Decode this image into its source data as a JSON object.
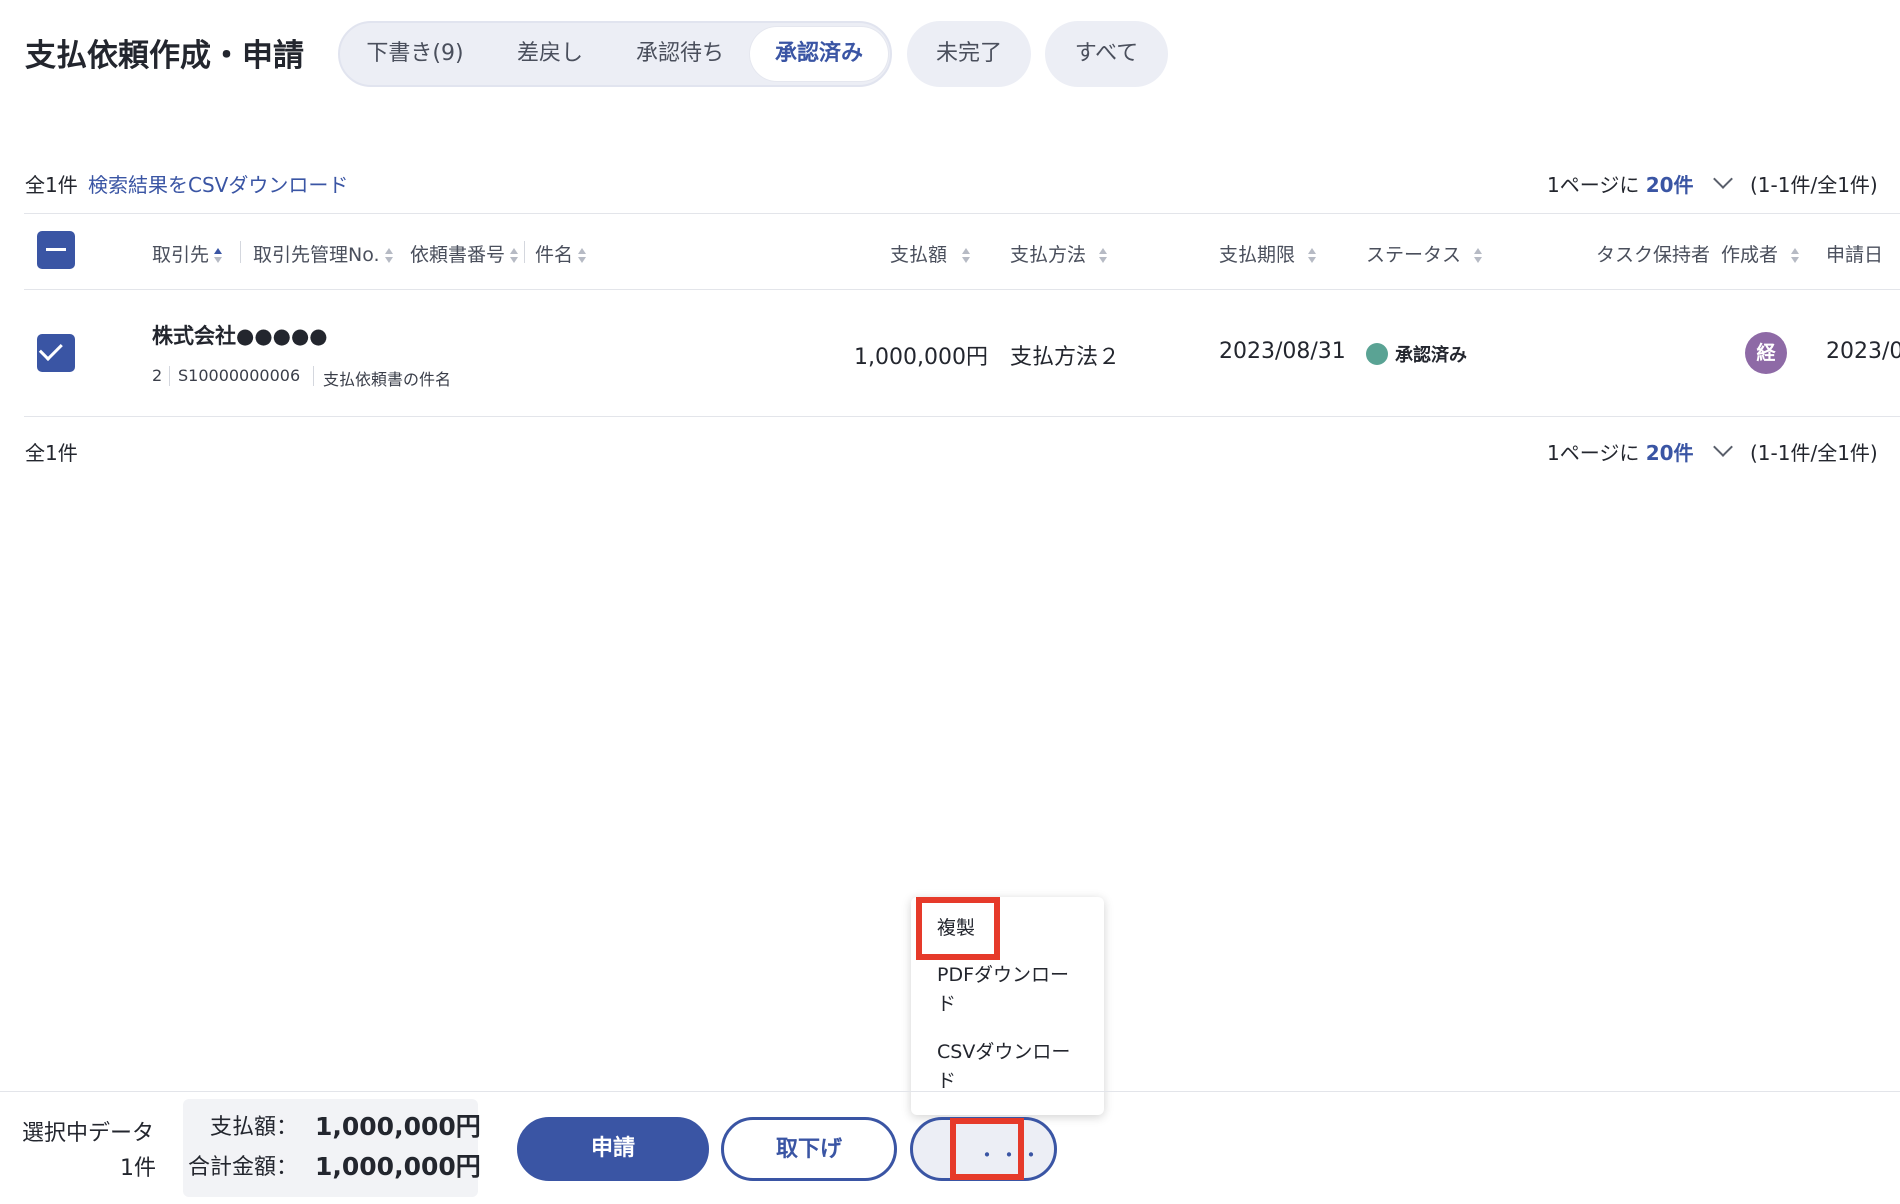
{
  "page_title": "支払依頼作成・申請",
  "tabs": [
    {
      "label": "下書き(9)"
    },
    {
      "label": "差戻し"
    },
    {
      "label": "承認待ち"
    },
    {
      "label": "承認済み"
    }
  ],
  "extra_tabs": [
    {
      "label": "未完了"
    },
    {
      "label": "すべて"
    }
  ],
  "top_bar": {
    "count": "全1件",
    "csv_link": "検索結果をCSVダウンロード",
    "per_page_prefix": "1ページに",
    "per_page_value": "20件",
    "range": "(1-1件/全1件)"
  },
  "table": {
    "columns": {
      "vendor": "取引先",
      "vendor_no": "取引先管理No.",
      "request_no": "依頼書番号",
      "subject": "件名",
      "amount": "支払額",
      "method": "支払方法",
      "due": "支払期限",
      "status": "ステータス",
      "task_owner": "タスク保持者",
      "creator": "作成者",
      "apply_date": "申請日"
    },
    "row": {
      "vendor": "株式会社●●●●●",
      "vendor_no": "2",
      "request_no": "S10000000006",
      "subject": "支払依頼書の件名",
      "amount": "1,000,000円",
      "method": "支払方法２",
      "due": "2023/08/31",
      "status": "承認済み",
      "status_color": "#5aa394",
      "creator_avatar": "経",
      "apply_date": "2023/0"
    }
  },
  "bottom_pager": {
    "count": "全1件",
    "per_page_prefix": "1ページに",
    "per_page_value": "20件",
    "range": "(1-1件/全1件)"
  },
  "menu": {
    "items": [
      "複製",
      "PDFダウンロード",
      "CSVダウンロード"
    ],
    "highlight_color": "#e63a2a"
  },
  "bottom_bar": {
    "selected_label": "選択中データ",
    "selected_count": "1件",
    "amount_label": "支払額：",
    "amount_value": "1,000,000円",
    "total_label": "合計金額：",
    "total_value": "1,000,000円",
    "apply_button": "申請",
    "withdraw_button": "取下げ",
    "more_button": "・・・"
  },
  "accent_color": "#3a55a4"
}
